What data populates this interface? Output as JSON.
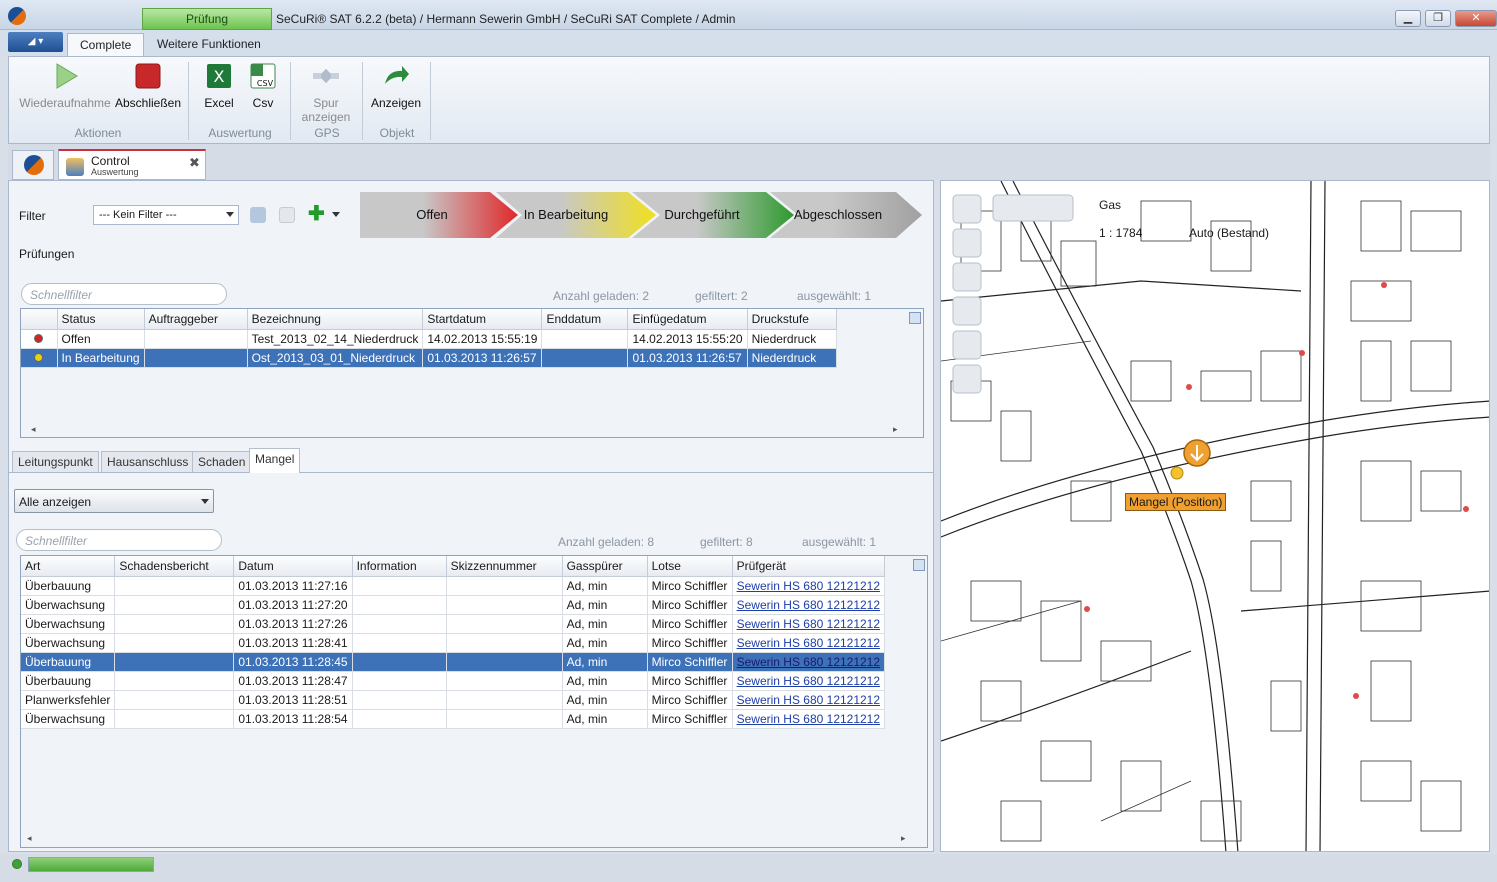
{
  "window": {
    "title": "SeCuRi® SAT 6.2.2 (beta) / Hermann Sewerin GmbH / SeCuRi SAT Complete / Admin",
    "context_tab": "Prüfung",
    "min_label": "▁",
    "max_label": "❐",
    "close_label": "✕"
  },
  "ribbon": {
    "app_menu_label": "◢ ▾",
    "tabs": [
      "Complete",
      "Weitere Funktionen"
    ],
    "buttons": {
      "wiederaufnahme": "Wiederaufnahme",
      "abschliessen": "Abschließen",
      "excel": "Excel",
      "csv": "Csv",
      "spur_line1": "Spur",
      "spur_line2": "anzeigen",
      "anzeigen": "Anzeigen"
    },
    "groups": [
      "Aktionen",
      "Auswertung",
      "GPS",
      "Objekt"
    ],
    "colors": {
      "play": "#7dc36a",
      "stop": "#c8282a",
      "excel": "#1f7a3a",
      "anzeigen": "#2e8b3e"
    }
  },
  "doc_tab": {
    "title": "Control",
    "subtitle": "Auswertung",
    "close": "✖"
  },
  "filter": {
    "label": "Filter",
    "selected": "--- Kein Filter ---",
    "add_symbol": "✚"
  },
  "workflow": [
    {
      "label": "Offen",
      "color": "#e0282a"
    },
    {
      "label": "In Bearbeitung",
      "color": "#f0e020"
    },
    {
      "label": "Durchgeführt",
      "color": "#2e9a2e"
    },
    {
      "label": "Abgeschlossen",
      "color": "#a0a0a0"
    }
  ],
  "pruefungen": {
    "label": "Prüfungen",
    "quickfilter_placeholder": "Schnellfilter",
    "stats": {
      "geladen": "Anzahl geladen: 2",
      "gefiltert": "gefiltert: 2",
      "ausgewaehlt": "ausgewählt: 1"
    },
    "columns": [
      "",
      "Status",
      "Auftraggeber",
      "Bezeichnung",
      "Startdatum",
      "Enddatum",
      "Einfügedatum",
      "Druckstufe"
    ],
    "rows": [
      {
        "dot": "#c8282a",
        "status": "Offen",
        "auftraggeber": "",
        "bezeichnung": "Test_2013_02_14_Niederdruck",
        "start": "14.02.2013 15:55:19",
        "ende": "",
        "einfuege": "14.02.2013 15:55:20",
        "druck": "Niederdruck"
      },
      {
        "dot": "#e8d20a",
        "status": "In Bearbeitung",
        "auftraggeber": "",
        "bezeichnung": "Ost_2013_03_01_Niederdruck",
        "start": "01.03.2013 11:26:57",
        "ende": "",
        "einfuege": "01.03.2013 11:26:57",
        "druck": "Niederdruck",
        "selected": true
      }
    ]
  },
  "subtabs": [
    "Leitungspunkt",
    "Hausanschluss",
    "Schaden",
    "Mangel"
  ],
  "mangel": {
    "dropdown": "Alle anzeigen",
    "quickfilter_placeholder": "Schnellfilter",
    "stats": {
      "geladen": "Anzahl geladen: 8",
      "gefiltert": "gefiltert: 8",
      "ausgewaehlt": "ausgewählt: 1"
    },
    "columns": [
      "Art",
      "Schadensbericht",
      "Datum",
      "Information",
      "Skizzennummer",
      "Gasspürer",
      "Lotse",
      "Prüfgerät"
    ],
    "rows": [
      {
        "art": "Überbauung",
        "bericht": "",
        "datum": "01.03.2013 11:27:16",
        "info": "",
        "skizze": "",
        "gas": "Ad, min",
        "lotse": "Mirco Schiffler",
        "geraet": "Sewerin HS 680 12121212"
      },
      {
        "art": "Überwachsung",
        "bericht": "",
        "datum": "01.03.2013 11:27:20",
        "info": "",
        "skizze": "",
        "gas": "Ad, min",
        "lotse": "Mirco Schiffler",
        "geraet": "Sewerin HS 680 12121212"
      },
      {
        "art": "Überwachsung",
        "bericht": "",
        "datum": "01.03.2013 11:27:26",
        "info": "",
        "skizze": "",
        "gas": "Ad, min",
        "lotse": "Mirco Schiffler",
        "geraet": "Sewerin HS 680 12121212"
      },
      {
        "art": "Überwachsung",
        "bericht": "",
        "datum": "01.03.2013 11:28:41",
        "info": "",
        "skizze": "",
        "gas": "Ad, min",
        "lotse": "Mirco Schiffler",
        "geraet": "Sewerin HS 680 12121212"
      },
      {
        "art": "Überbauung",
        "bericht": "",
        "datum": "01.03.2013 11:28:45",
        "info": "",
        "skizze": "",
        "gas": "Ad, min",
        "lotse": "Mirco Schiffler",
        "geraet": "Sewerin HS 680 12121212",
        "selected": true
      },
      {
        "art": "Überbauung",
        "bericht": "",
        "datum": "01.03.2013 11:28:47",
        "info": "",
        "skizze": "",
        "gas": "Ad, min",
        "lotse": "Mirco Schiffler",
        "geraet": "Sewerin HS 680 12121212"
      },
      {
        "art": "Planwerksfehler",
        "bericht": "",
        "datum": "01.03.2013 11:28:51",
        "info": "",
        "skizze": "",
        "gas": "Ad, min",
        "lotse": "Mirco Schiffler",
        "geraet": "Sewerin HS 680 12121212"
      },
      {
        "art": "Überwachsung",
        "bericht": "",
        "datum": "01.03.2013 11:28:54",
        "info": "",
        "skizze": "",
        "gas": "Ad, min",
        "lotse": "Mirco Schiffler",
        "geraet": "Sewerin HS 680 12121212"
      }
    ]
  },
  "map": {
    "layer": "Gas",
    "scale": "1 : 1784",
    "mode": "Auto (Bestand)",
    "marker_label": "Mangel (Position)",
    "marker_color": "#f0a030"
  },
  "status": {
    "progress_fraction": 1.0
  }
}
